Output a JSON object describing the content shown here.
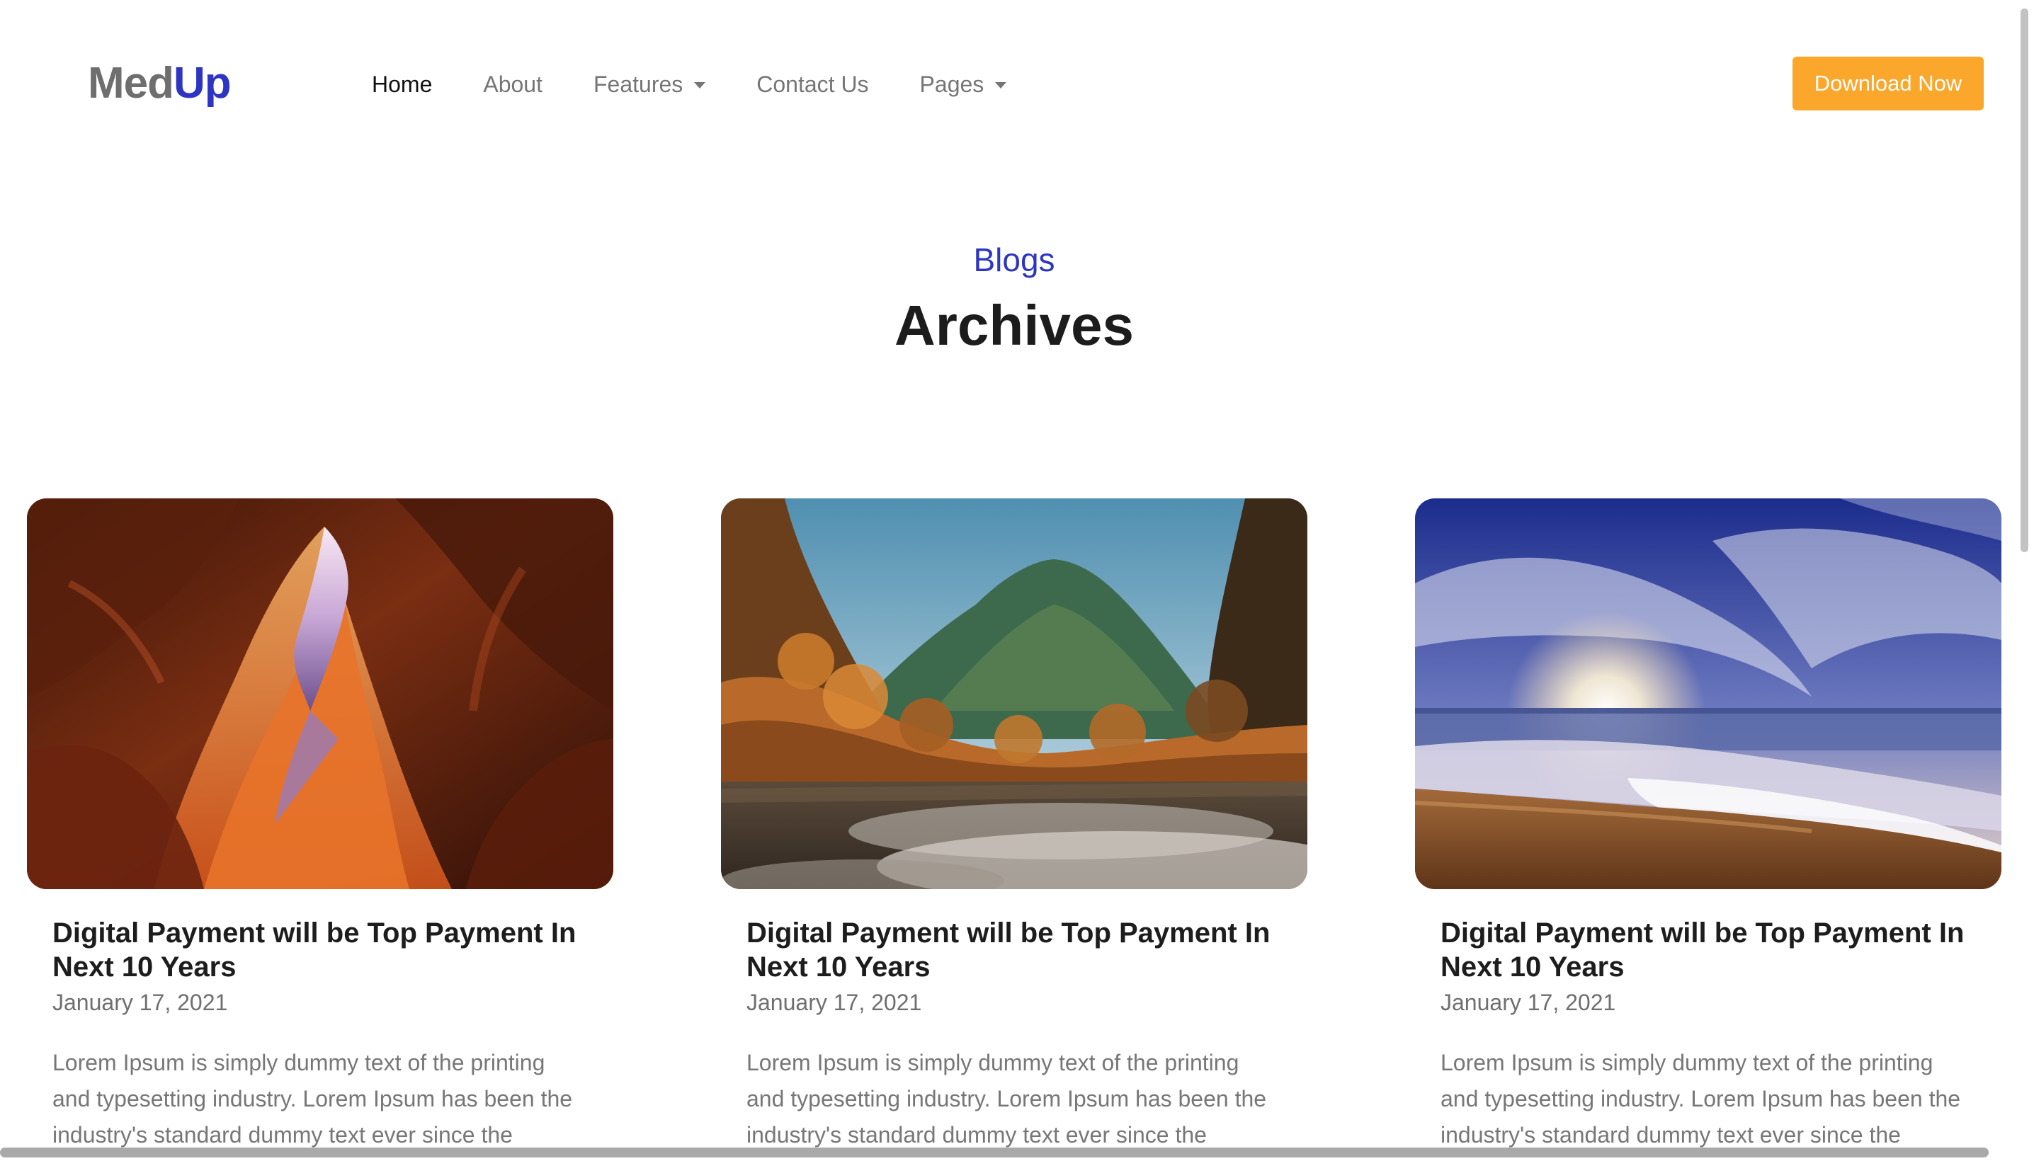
{
  "brand": {
    "name_part1": "Med",
    "name_part2": "Up",
    "colors": {
      "primary": "#2d35c2",
      "accent": "#fba72c",
      "logo_gray": "#6e6e6e"
    }
  },
  "nav": {
    "items": [
      {
        "label": "Home",
        "active": true,
        "has_dropdown": false
      },
      {
        "label": "About",
        "active": false,
        "has_dropdown": false
      },
      {
        "label": "Features",
        "active": false,
        "has_dropdown": true
      },
      {
        "label": "Contact Us",
        "active": false,
        "has_dropdown": false
      },
      {
        "label": "Pages",
        "active": false,
        "has_dropdown": true
      }
    ],
    "cta_label": "Download Now"
  },
  "section": {
    "eyebrow": "Blogs",
    "title": "Archives"
  },
  "posts": [
    {
      "image_icon": "canyon-photo",
      "title": "Digital Payment will be Top Payment In Next 10 Years",
      "date": "January 17, 2021",
      "excerpt": "Lorem Ipsum is simply dummy text of the printing and typesetting industry. Lorem Ipsum has been the industry's standard dummy text ever since the"
    },
    {
      "image_icon": "autumn-mountain-river-photo",
      "title": "Digital Payment will be Top Payment In Next 10 Years",
      "date": "January 17, 2021",
      "excerpt": "Lorem Ipsum is simply dummy text of the printing and typesetting industry. Lorem Ipsum has been the industry's standard dummy text ever since the"
    },
    {
      "image_icon": "beach-sunset-photo",
      "title": "Digital Payment will be Top Payment In Next 10 Years",
      "date": "January 17, 2021",
      "excerpt": "Lorem Ipsum is simply dummy text of the printing and typesetting industry. Lorem Ipsum has been the industry's standard dummy text ever since the"
    }
  ]
}
